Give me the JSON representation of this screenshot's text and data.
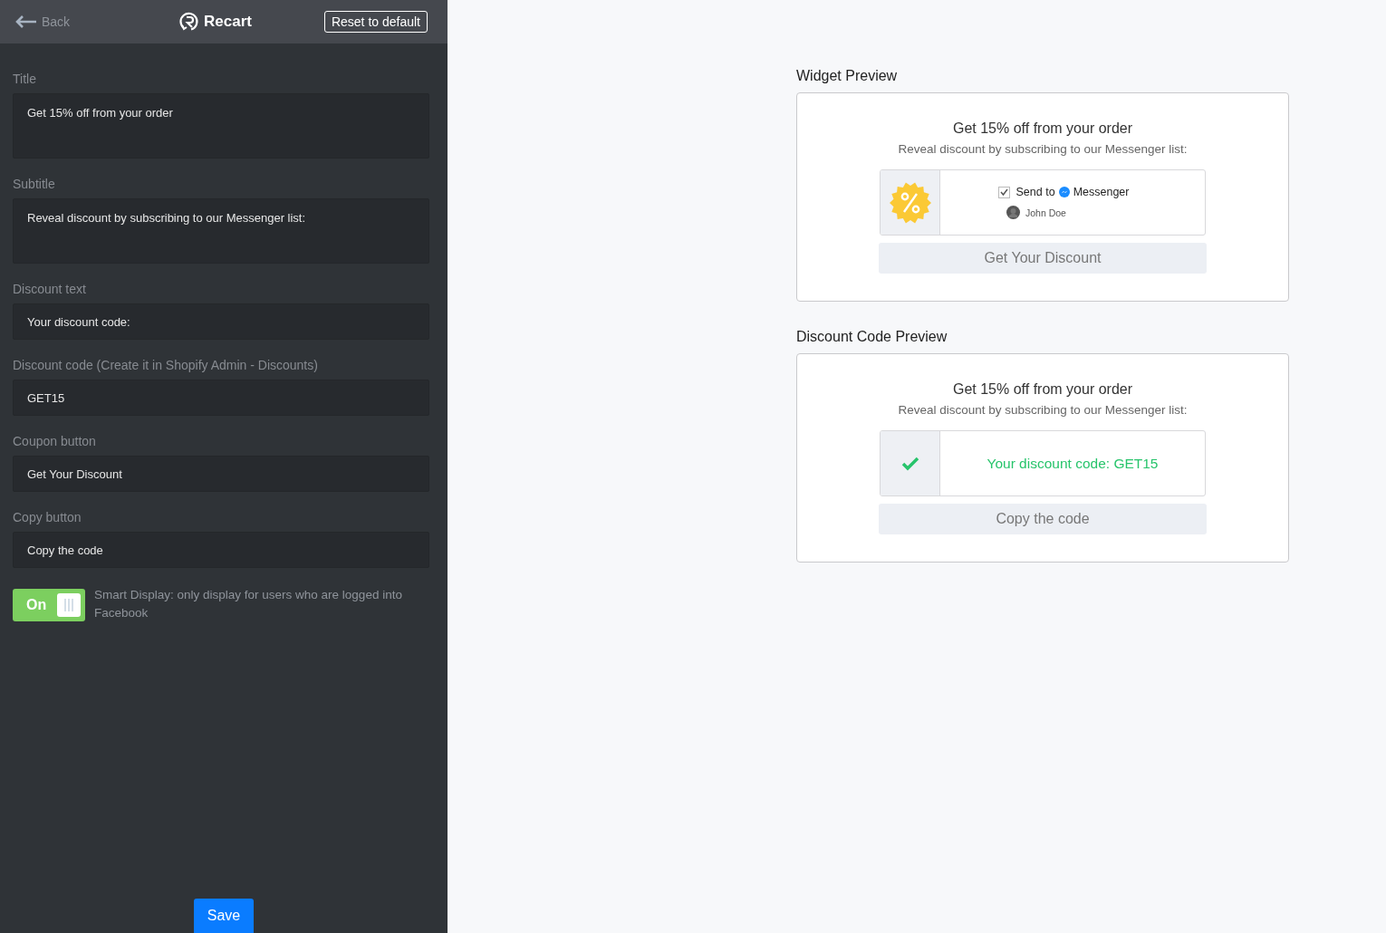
{
  "header": {
    "back": "Back",
    "logo": "Recart",
    "reset_button": "Reset to default"
  },
  "fields": [
    {
      "label": "Title",
      "value": "Get 15% off from your order",
      "kind": "textarea"
    },
    {
      "label": "Subtitle",
      "value": "Reveal discount by subscribing to our Messenger list:",
      "kind": "textarea"
    },
    {
      "label": "Discount text",
      "value": "Your discount code:",
      "kind": "input"
    },
    {
      "label": "Discount code (Create it in Shopify Admin - Discounts)",
      "value": "GET15",
      "kind": "input"
    },
    {
      "label": "Coupon button",
      "value": "Get Your Discount",
      "kind": "input"
    },
    {
      "label": "Copy button",
      "value": "Copy the code",
      "kind": "input"
    }
  ],
  "smart_display": {
    "toggle_label": "On",
    "on": true,
    "text": "Smart Display: only display for users who are logged into Facebook"
  },
  "save_button": "Save",
  "widget_preview": {
    "heading": "Widget Preview",
    "title": "Get 15% off from your order",
    "subtitle": "Reveal discount by subscribing to our Messenger list:",
    "checked": true,
    "send_to": "Send to",
    "messenger": "Messenger",
    "user_name": "John Doe",
    "button": "Get Your Discount"
  },
  "discount_code_preview": {
    "heading": "Discount Code Preview",
    "title": "Get 15% off from your order",
    "subtitle": "Reveal discount by subscribing to our Messenger list:",
    "code_text": "Your discount code: GET15",
    "button": "Copy the code"
  }
}
